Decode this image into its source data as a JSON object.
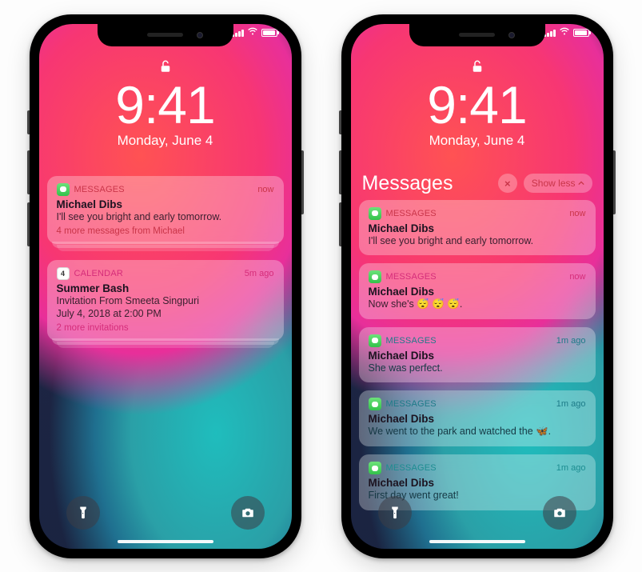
{
  "time": "9:41",
  "date": "Monday, June 4",
  "left": {
    "messages": {
      "app_label": "MESSAGES",
      "timestamp": "now",
      "title": "Michael Dibs",
      "body": "I'll see you bright and early tomorrow.",
      "more": "4 more messages from Michael"
    },
    "calendar": {
      "app_label": "CALENDAR",
      "icon_day": "4",
      "timestamp": "5m ago",
      "title": "Summer Bash",
      "body_line1": "Invitation From Smeeta Singpuri",
      "body_line2": "July 4, 2018 at 2:00 PM",
      "more": "2 more invitations"
    }
  },
  "right": {
    "group_title": "Messages",
    "show_less": "Show less",
    "notifications": [
      {
        "app_label": "MESSAGES",
        "timestamp": "now",
        "title": "Michael Dibs",
        "body": "I'll see you bright and early tomorrow."
      },
      {
        "app_label": "MESSAGES",
        "timestamp": "now",
        "title": "Michael Dibs",
        "body": "Now she's 😴 😴 😴."
      },
      {
        "app_label": "MESSAGES",
        "timestamp": "1m ago",
        "title": "Michael Dibs",
        "body": "She was perfect."
      },
      {
        "app_label": "MESSAGES",
        "timestamp": "1m ago",
        "title": "Michael Dibs",
        "body": "We went to the park and watched the 🦋."
      },
      {
        "app_label": "MESSAGES",
        "timestamp": "1m ago",
        "title": "Michael Dibs",
        "body": "First day went great!"
      }
    ]
  },
  "icons": {
    "lock": "lock-open",
    "flashlight": "flashlight",
    "camera": "camera",
    "close": "×",
    "chevron_up": "chevron-up"
  }
}
